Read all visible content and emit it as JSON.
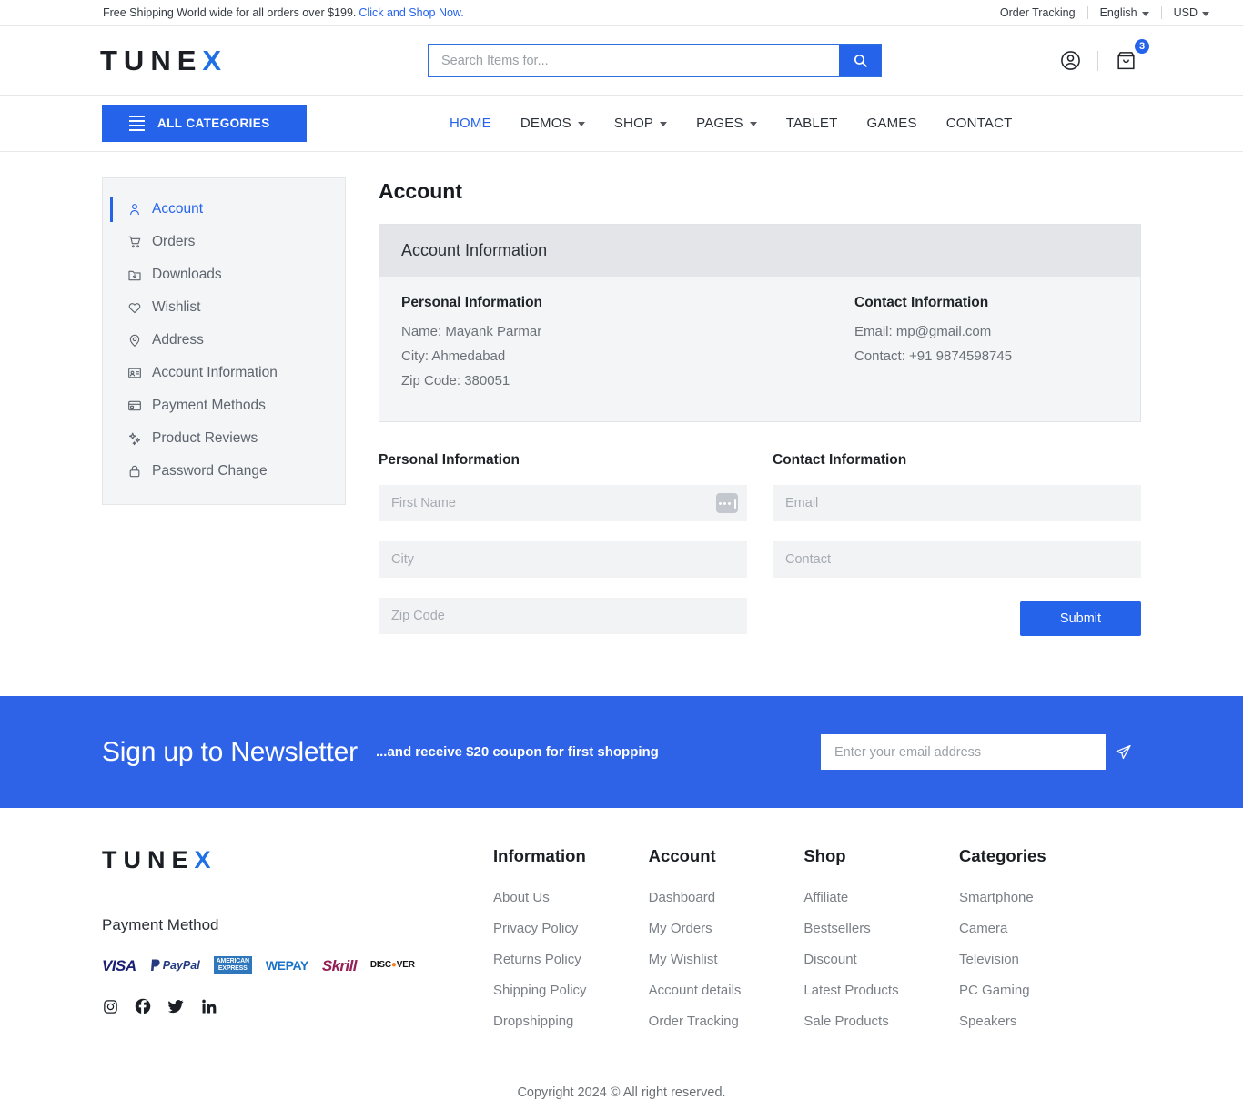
{
  "topbar": {
    "promo_text": "Free Shipping World wide for all orders over $199.",
    "promo_link": "Click and Shop Now.",
    "order_tracking": "Order Tracking",
    "language": "English",
    "currency": "USD"
  },
  "header": {
    "logo_main": "TUNE",
    "logo_accent": "X",
    "search_placeholder": "Search Items for...",
    "search_value": "",
    "cart_count": "3"
  },
  "nav": {
    "all_categories": "ALL CATEGORIES",
    "items": [
      {
        "label": "HOME",
        "active": true,
        "caret": false
      },
      {
        "label": "DEMOS",
        "active": false,
        "caret": true
      },
      {
        "label": "SHOP",
        "active": false,
        "caret": true
      },
      {
        "label": "PAGES",
        "active": false,
        "caret": true
      },
      {
        "label": "TABLET",
        "active": false,
        "caret": false
      },
      {
        "label": "GAMES",
        "active": false,
        "caret": false
      },
      {
        "label": "CONTACT",
        "active": false,
        "caret": false
      }
    ]
  },
  "sidebar": {
    "items": [
      {
        "label": "Account",
        "icon": "user-icon",
        "active": true
      },
      {
        "label": "Orders",
        "icon": "cart-icon",
        "active": false
      },
      {
        "label": "Downloads",
        "icon": "download-folder-icon",
        "active": false
      },
      {
        "label": "Wishlist",
        "icon": "heart-icon",
        "active": false
      },
      {
        "label": "Address",
        "icon": "location-pin-icon",
        "active": false
      },
      {
        "label": "Account Information",
        "icon": "id-card-icon",
        "active": false
      },
      {
        "label": "Payment Methods",
        "icon": "credit-card-icon",
        "active": false
      },
      {
        "label": "Product Reviews",
        "icon": "sparkles-icon",
        "active": false
      },
      {
        "label": "Password Change",
        "icon": "lock-icon",
        "active": false
      }
    ]
  },
  "main": {
    "page_title": "Account",
    "card": {
      "heading": "Account Information",
      "personal_title": "Personal Information",
      "personal_lines": [
        "Name: Mayank Parmar",
        "City: Ahmedabad",
        "Zip Code: 380051"
      ],
      "contact_title": "Contact Information",
      "contact_lines": [
        "Email: mp@gmail.com",
        "Contact: +91 9874598745"
      ]
    },
    "form": {
      "personal_title": "Personal Information",
      "contact_title": "Contact Information",
      "first_name_placeholder": "First Name",
      "first_name_value": "",
      "city_placeholder": "City",
      "city_value": "",
      "zip_placeholder": "Zip Code",
      "zip_value": "",
      "email_placeholder": "Email",
      "email_value": "",
      "contact_placeholder": "Contact",
      "contact_value": "",
      "submit_label": "Submit"
    }
  },
  "newsletter": {
    "title": "Sign up to Newsletter",
    "subtitle": "...and receive $20 coupon for first shopping",
    "email_placeholder": "Enter your email address",
    "email_value": ""
  },
  "footer": {
    "logo_main": "TUNE",
    "logo_accent": "X",
    "payment_title": "Payment Method",
    "payment_methods": [
      "VISA",
      "PayPal",
      "AMERICAN EXPRESS",
      "WEPAY",
      "Skrill",
      "DISCOVER"
    ],
    "socials": [
      "instagram-icon",
      "facebook-icon",
      "twitter-icon",
      "linkedin-icon"
    ],
    "columns": [
      {
        "title": "Information",
        "links": [
          "About Us",
          "Privacy Policy",
          "Returns Policy",
          "Shipping Policy",
          "Dropshipping"
        ]
      },
      {
        "title": "Account",
        "links": [
          "Dashboard",
          "My Orders",
          "My Wishlist",
          "Account details",
          "Order Tracking"
        ]
      },
      {
        "title": "Shop",
        "links": [
          "Affiliate",
          "Bestsellers",
          "Discount",
          "Latest Products",
          "Sale Products"
        ]
      },
      {
        "title": "Categories",
        "links": [
          "Smartphone",
          "Camera",
          "Television",
          "PC Gaming",
          "Speakers"
        ]
      }
    ],
    "copyright": "Copyright 2024 © All right reserved."
  },
  "colors": {
    "accent_blue": "#2563eb",
    "newsletter_blue": "#2e63e8",
    "card_bg": "#f4f5f7",
    "card_head_bg": "#e3e5e8",
    "input_bg": "#f2f3f5",
    "muted_text": "#6b7177"
  }
}
